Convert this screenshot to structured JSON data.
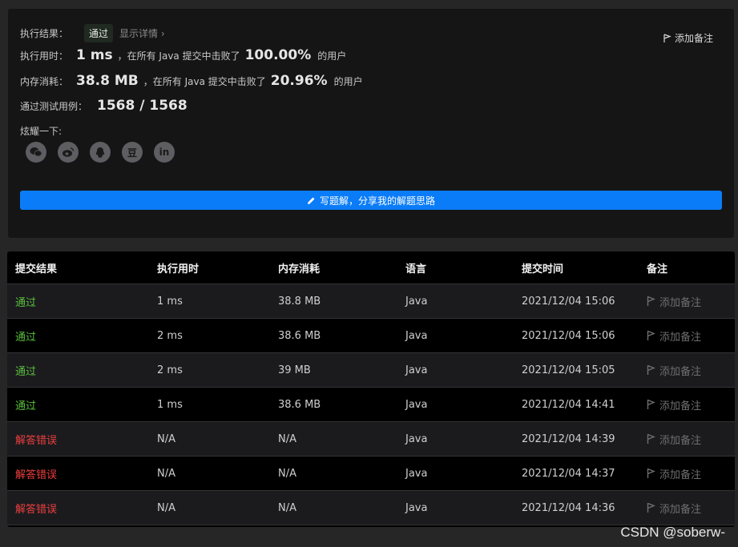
{
  "result": {
    "status_label": "执行结果：",
    "status_badge": "通过",
    "details_link": "显示详情 ›",
    "add_note": "添加备注",
    "runtime": {
      "label": "执行用时：",
      "value": "1 ms",
      "middle": "，在所有 Java 提交中击败了",
      "percent": "100.00%",
      "suffix": "的用户"
    },
    "memory": {
      "label": "内存消耗：",
      "value": "38.8 MB",
      "middle": "，在所有 Java 提交中击败了",
      "percent": "20.96%",
      "suffix": "的用户"
    },
    "testcases": {
      "label": "通过测试用例：",
      "value": "1568 / 1568"
    },
    "share_label": "炫耀一下:",
    "share_icons": [
      "wechat-icon",
      "weibo-icon",
      "qq-icon",
      "douban-icon",
      "linkedin-icon"
    ],
    "douban_glyph": "豆",
    "linkedin_glyph": "in",
    "write_button": "写题解，分享我的解题思路"
  },
  "table": {
    "headers": [
      "提交结果",
      "执行用时",
      "内存消耗",
      "语言",
      "提交时间",
      "备注"
    ],
    "rows": [
      {
        "status": "通过",
        "pass": true,
        "time": "1 ms",
        "memory": "38.8 MB",
        "lang": "Java",
        "submitted": "2021/12/04 15:06",
        "note": "添加备注"
      },
      {
        "status": "通过",
        "pass": true,
        "time": "2 ms",
        "memory": "38.6 MB",
        "lang": "Java",
        "submitted": "2021/12/04 15:06",
        "note": "添加备注"
      },
      {
        "status": "通过",
        "pass": true,
        "time": "2 ms",
        "memory": "39 MB",
        "lang": "Java",
        "submitted": "2021/12/04 15:05",
        "note": "添加备注"
      },
      {
        "status": "通过",
        "pass": true,
        "time": "1 ms",
        "memory": "38.6 MB",
        "lang": "Java",
        "submitted": "2021/12/04 14:41",
        "note": "添加备注"
      },
      {
        "status": "解答错误",
        "pass": false,
        "time": "N/A",
        "memory": "N/A",
        "lang": "Java",
        "submitted": "2021/12/04 14:39",
        "note": "添加备注"
      },
      {
        "status": "解答错误",
        "pass": false,
        "time": "N/A",
        "memory": "N/A",
        "lang": "Java",
        "submitted": "2021/12/04 14:37",
        "note": "添加备注"
      },
      {
        "status": "解答错误",
        "pass": false,
        "time": "N/A",
        "memory": "N/A",
        "lang": "Java",
        "submitted": "2021/12/04 14:36",
        "note": "添加备注"
      }
    ]
  },
  "colors": {
    "pass": "#5bbf3c",
    "fail": "#ef3e3e",
    "accent": "#0a7cf7"
  },
  "watermark": "CSDN @soberw-"
}
